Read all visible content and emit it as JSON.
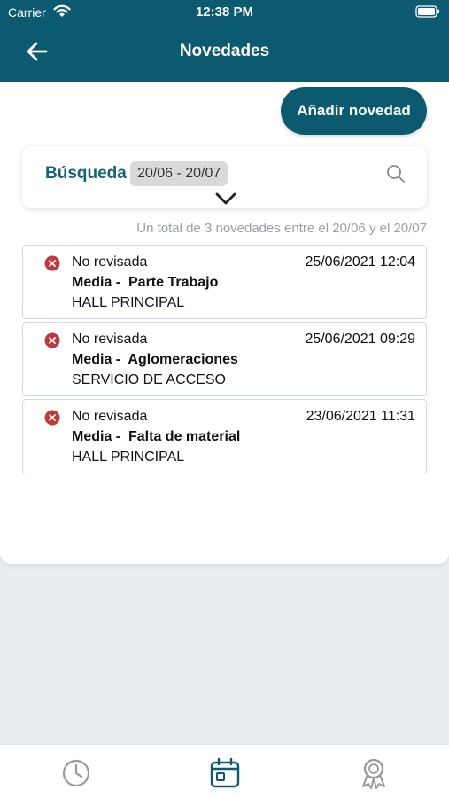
{
  "status_bar": {
    "carrier": "Carrier",
    "time": "12:38 PM"
  },
  "header": {
    "title": "Novedades",
    "back_icon": "arrow-left-icon"
  },
  "actions": {
    "add_label": "Añadir novedad"
  },
  "search": {
    "label": "Búsqueda",
    "date_range": "20/06 - 20/07",
    "icon": "search-icon"
  },
  "summary": {
    "text": "Un total de 3 novedades entre el 20/06 y el 20/07"
  },
  "colors": {
    "primary": "#0b5a70",
    "status_red": "#c0393b",
    "chip_bg": "#d9d9d9"
  },
  "items": [
    {
      "status": "No revisada",
      "datetime": "25/06/2021 12:04",
      "title": "Media -  Parte Trabajo",
      "location": "HALL PRINCIPAL"
    },
    {
      "status": "No revisada",
      "datetime": "25/06/2021 09:29",
      "title": "Media -  Aglomeraciones",
      "location": "SERVICIO DE ACCESO"
    },
    {
      "status": "No revisada",
      "datetime": "23/06/2021 11:31",
      "title": "Media -  Falta de material",
      "location": "HALL PRINCIPAL"
    }
  ],
  "tabs": [
    {
      "icon": "clock-icon",
      "active": false
    },
    {
      "icon": "calendar-icon",
      "active": true
    },
    {
      "icon": "award-icon",
      "active": false
    }
  ]
}
